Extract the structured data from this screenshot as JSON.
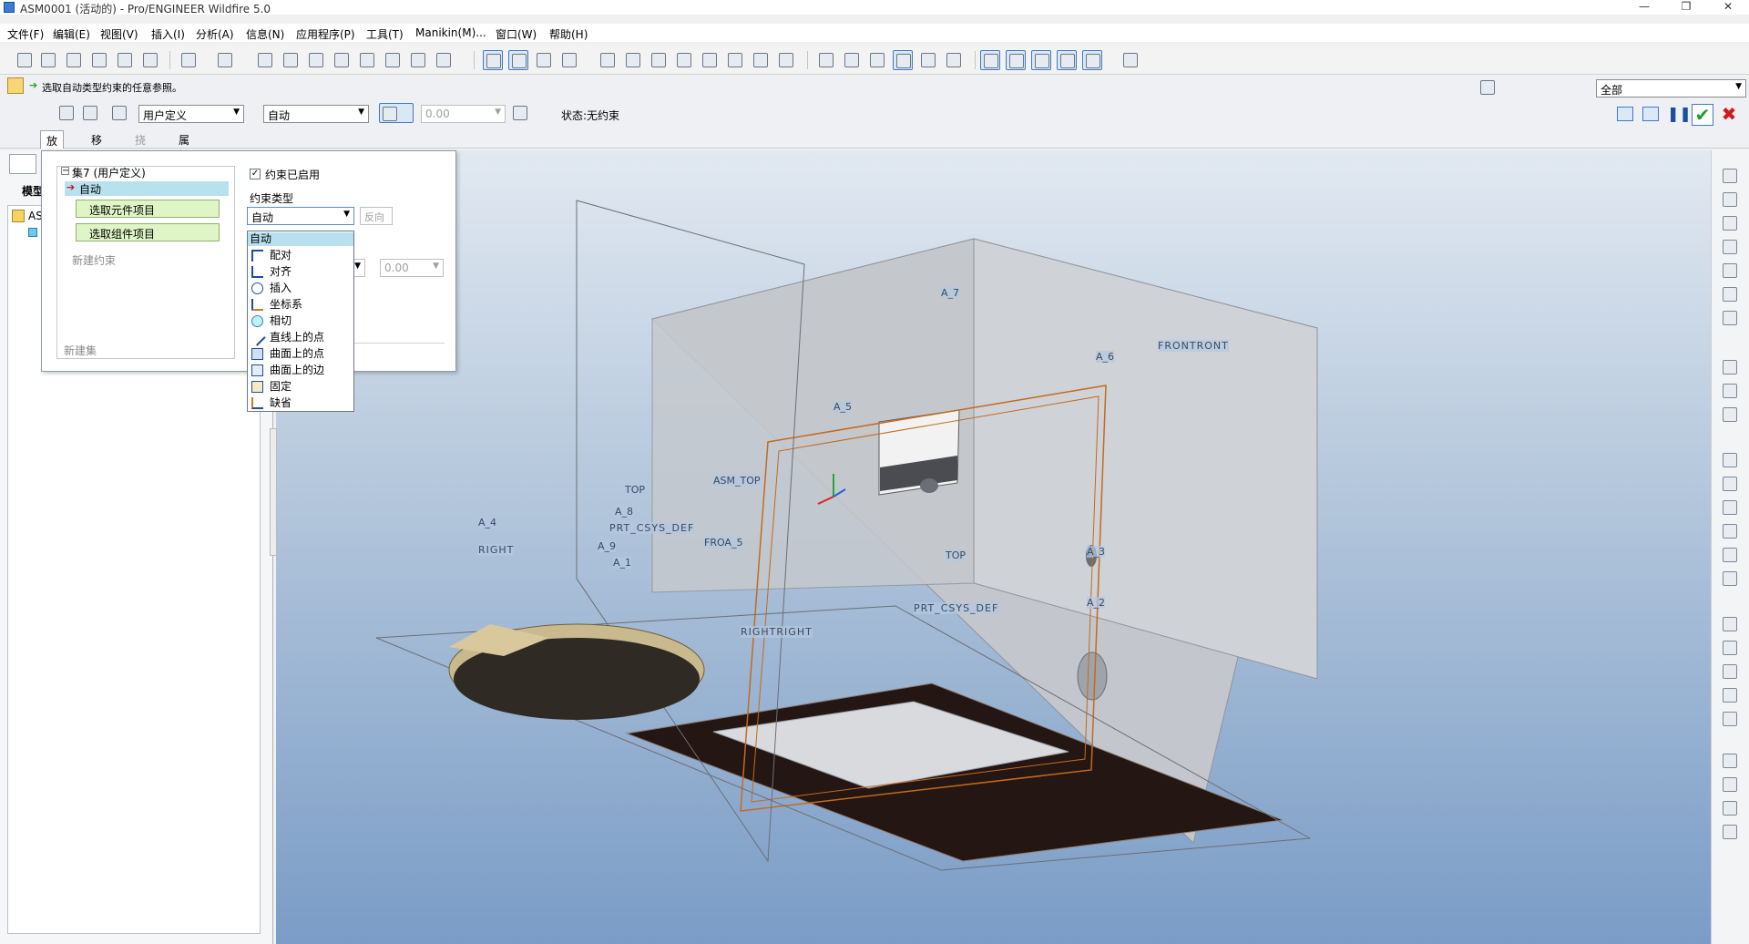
{
  "window": {
    "title": "ASM0001 (活动的) - Pro/ENGINEER Wildfire 5.0",
    "minimize": "—",
    "restore": "❐",
    "close": "✕"
  },
  "menu": [
    "文件(F)",
    "编辑(E)",
    "视图(V)",
    "插入(I)",
    "分析(A)",
    "信息(N)",
    "应用程序(P)",
    "工具(T)",
    "Manikin(M)...",
    "窗口(W)",
    "帮助(H)"
  ],
  "message": "选取自动类型约束的任意参照。",
  "filter": {
    "value": "全部"
  },
  "dashboard": {
    "set_type": "用户定义",
    "constraint_type": "自动",
    "offset_value": "0.00",
    "status": "状态:无约束",
    "tabs": [
      "放置",
      "移动",
      "挠性",
      "属性"
    ],
    "disabled_tab": "挠性"
  },
  "left_panel": {
    "tab_label": "模型",
    "tree_root": "AS"
  },
  "placement": {
    "set_label": "集7 (用户定义)",
    "constraint_selected": "自动",
    "pick_component": "选取元件项目",
    "pick_assembly": "选取组件项目",
    "new_constraint": "新建约束",
    "new_set": "新建集",
    "enabled_label": "约束已启用",
    "type_label": "约束类型",
    "type_value": "自动",
    "flip_label": "反向",
    "offset_value": "0.00"
  },
  "dropdown": {
    "items": [
      "自动",
      "配对",
      "对齐",
      "插入",
      "坐标系",
      "相切",
      "直线上的点",
      "曲面上的点",
      "曲面上的边",
      "固定",
      "缺省"
    ]
  },
  "viewport_labels": {
    "frontront": "FRONTRONT",
    "a7": "A_7",
    "a6": "A_6",
    "a5": "A_5",
    "asm_top": "ASM_TOP",
    "top1": "TOP",
    "top2": "TOP",
    "a3": "A_3",
    "a2": "A_2",
    "prt_csys_def": "PRT_CSYS_DEF",
    "rightright": "RIGHTRIGHT",
    "a4": "A_4",
    "right": "RIGHT",
    "prt_csys_def2": "PRT_CSYS_DEF",
    "froa": "FROA_5",
    "a1": "A_1",
    "a8": "A_8",
    "a9": "A_9"
  }
}
